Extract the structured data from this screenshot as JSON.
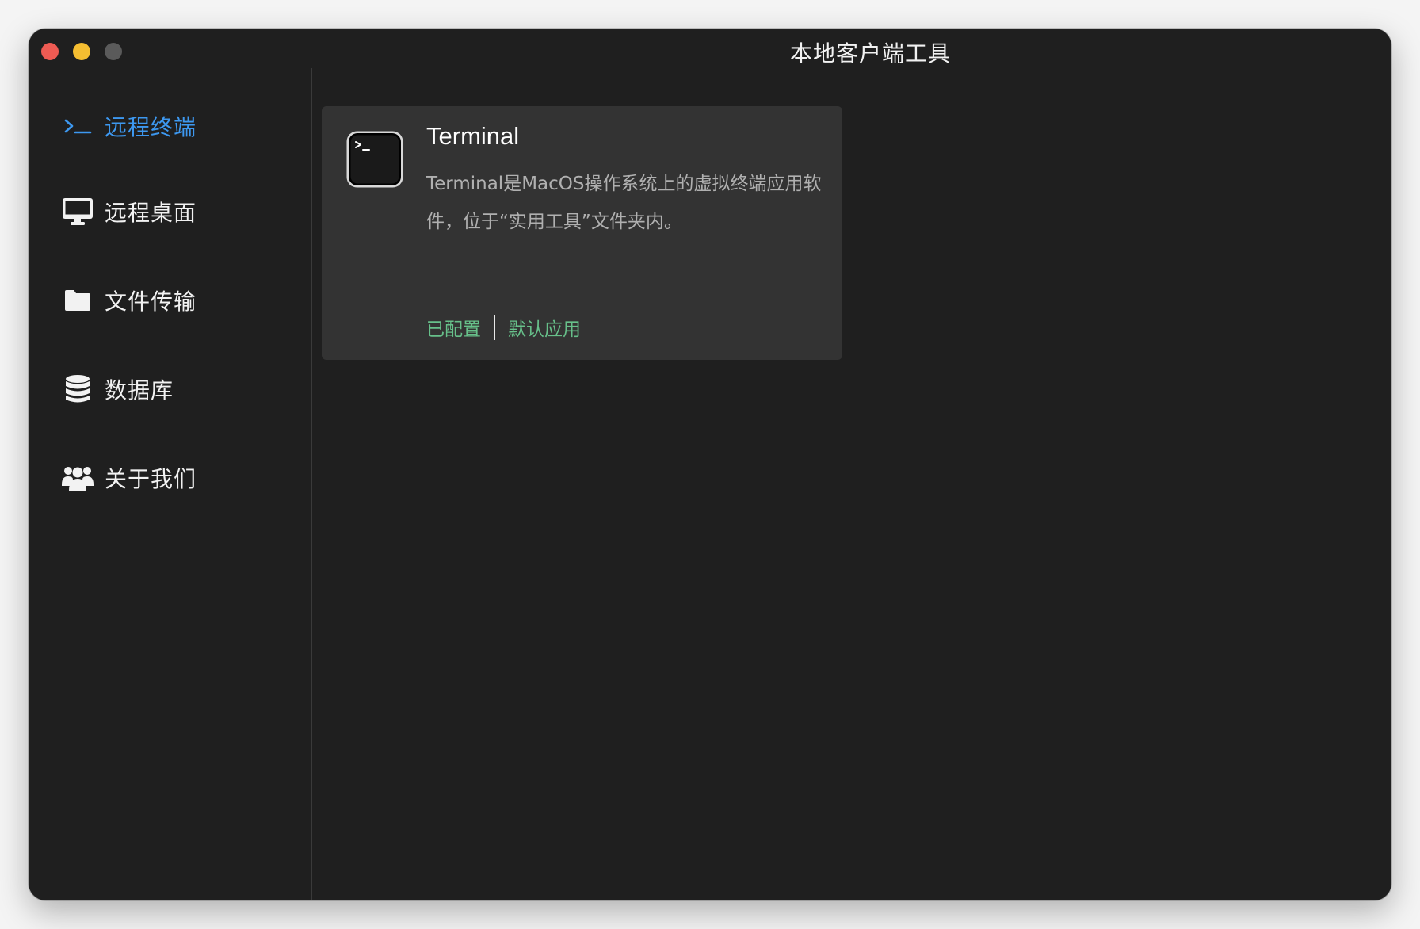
{
  "window": {
    "title": "本地客户端工具"
  },
  "sidebar": {
    "items": [
      {
        "label": "远程终端",
        "icon": "terminal-prompt-icon",
        "active": true
      },
      {
        "label": "远程桌面",
        "icon": "monitor-icon",
        "active": false
      },
      {
        "label": "文件传输",
        "icon": "folder-icon",
        "active": false
      },
      {
        "label": "数据库",
        "icon": "database-icon",
        "active": false
      },
      {
        "label": "关于我们",
        "icon": "users-icon",
        "active": false
      }
    ]
  },
  "card": {
    "icon": "terminal-app-icon",
    "title": "Terminal",
    "description": "Terminal是MacOS操作系统上的虚拟终端应用软件，位于“实用工具”文件夹内。",
    "actions": {
      "configured": "已配置",
      "default_app": "默认应用"
    }
  },
  "colors": {
    "window_bg": "#1f1f1f",
    "card_bg": "#333333",
    "accent_blue": "#3d98f0",
    "action_green": "#67c08a",
    "close": "#ee5b53",
    "minimize": "#f5be31",
    "maximize": "#5a5a5a"
  }
}
